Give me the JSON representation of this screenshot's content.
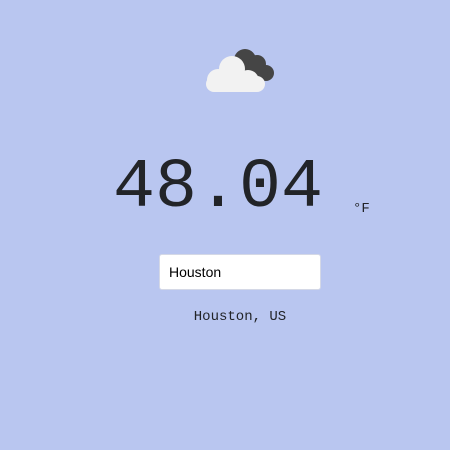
{
  "weather": {
    "icon": "cloudy-icon",
    "temperature": "48.04",
    "unit": "°F",
    "location": "Houston, US"
  },
  "search": {
    "value": "Houston",
    "placeholder": ""
  },
  "colors": {
    "background": "#b9c6f0",
    "text": "#222428",
    "cloud_front": "#f2f2f2",
    "cloud_back": "#444444"
  }
}
